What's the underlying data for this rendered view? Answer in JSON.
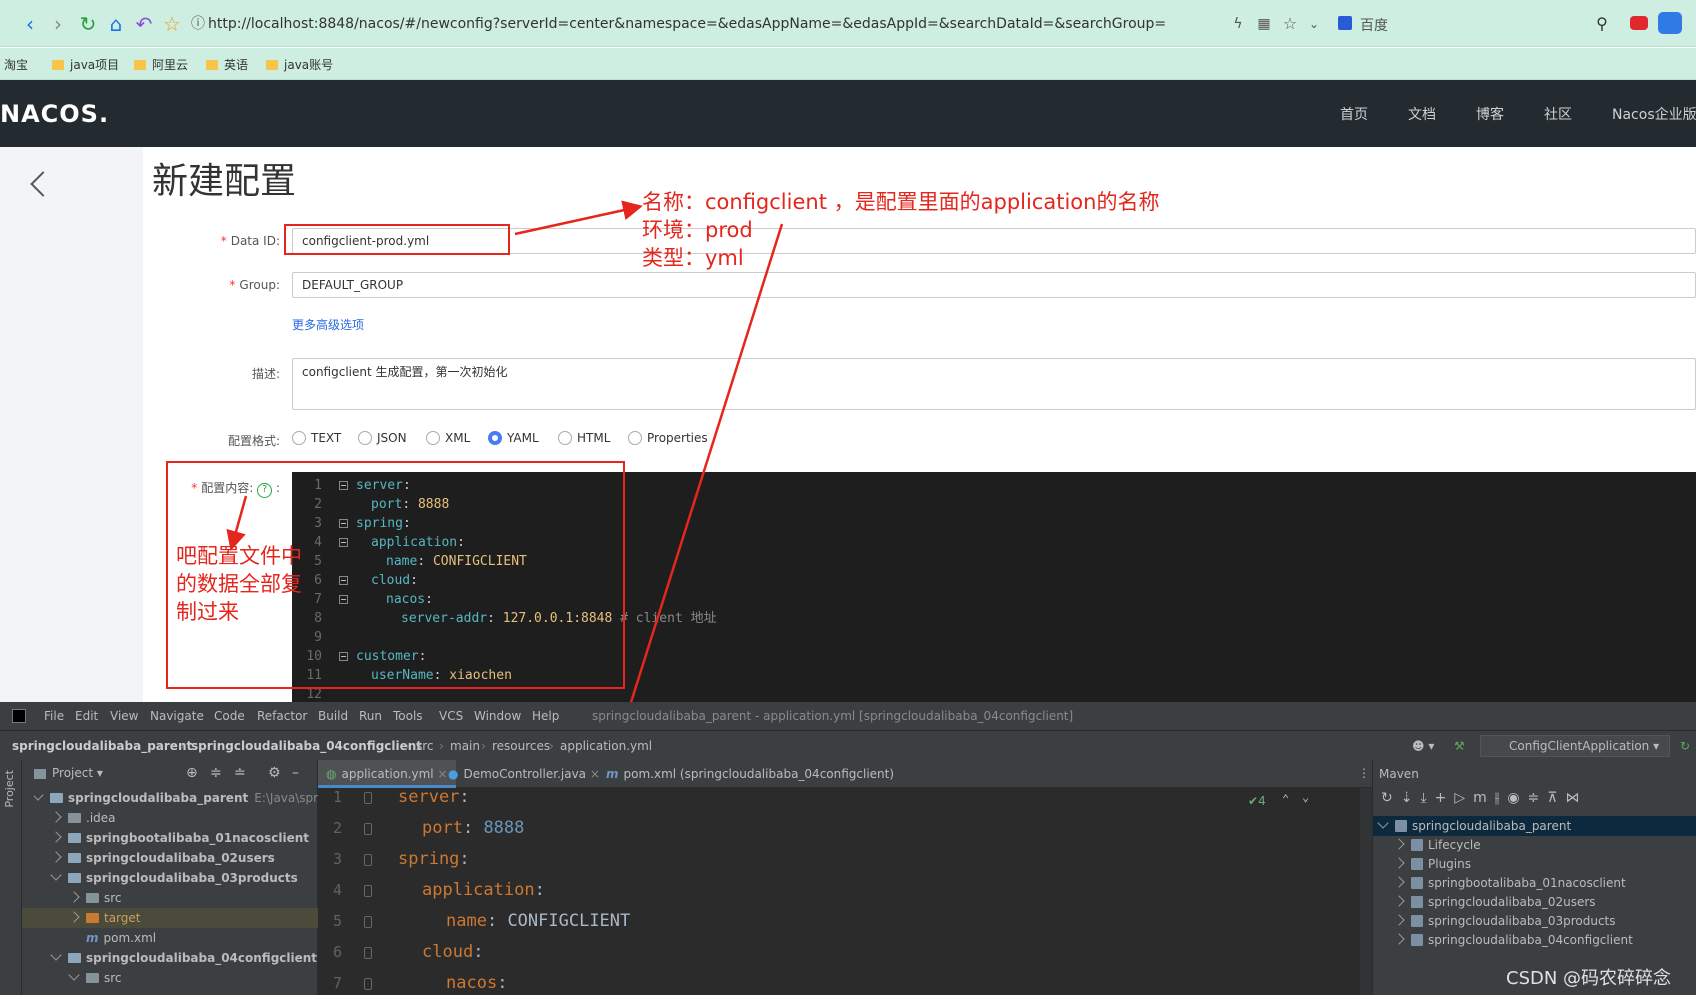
{
  "browser": {
    "url": "http://localhost:8848/nacos/#/newconfig?serverId=center&namespace=&edasAppName=&edasAppId=&searchDataId=&searchGroup=",
    "search_engine": "百度",
    "bookmarks": [
      "淘宝",
      "java项目",
      "阿里云",
      "英语",
      "java账号"
    ]
  },
  "nacos": {
    "logo": "NACOS.",
    "nav": [
      "首页",
      "文档",
      "博客",
      "社区",
      "Nacos企业版"
    ],
    "page_title": "新建配置",
    "form": {
      "data_id_label": "Data ID:",
      "data_id_value": "configclient-prod.yml",
      "group_label": "Group:",
      "group_value": "DEFAULT_GROUP",
      "advanced_link": "更多高级选项",
      "desc_label": "描述:",
      "desc_value": "configclient 生成配置，第一次初始化",
      "format_label": "配置格式:",
      "formats": [
        "TEXT",
        "JSON",
        "XML",
        "YAML",
        "HTML",
        "Properties"
      ],
      "format_selected": "YAML",
      "content_label": "配置内容:",
      "help_icon": "?",
      "colon": ":"
    },
    "editor_lines": [
      {
        "n": "1",
        "key": "server",
        "val": ""
      },
      {
        "n": "2",
        "key": "port",
        "val": "8888"
      },
      {
        "n": "3",
        "key": "spring",
        "val": ""
      },
      {
        "n": "4",
        "key": "application",
        "val": ""
      },
      {
        "n": "5",
        "key": "name",
        "val": "CONFIGCLIENT"
      },
      {
        "n": "6",
        "key": "cloud",
        "val": ""
      },
      {
        "n": "7",
        "key": "nacos",
        "val": ""
      },
      {
        "n": "8",
        "key": "server-addr",
        "val": "127.0.0.1:8848",
        "comment": "# client 地址"
      },
      {
        "n": "9",
        "key": "",
        "val": ""
      },
      {
        "n": "10",
        "key": "customer",
        "val": ""
      },
      {
        "n": "11",
        "key": "userName",
        "val": "xiaochen"
      },
      {
        "n": "12",
        "key": "",
        "val": ""
      }
    ]
  },
  "annotations": {
    "note_name": "名称：configclient ，是配置里面的application的名称",
    "note_env": "环境：prod",
    "note_type": "类型：yml",
    "note_copy": "吧配置文件中的数据全部复制过来"
  },
  "ide": {
    "menu": [
      "File",
      "Edit",
      "View",
      "Navigate",
      "Code",
      "Refactor",
      "Build",
      "Run",
      "Tools",
      "VCS",
      "Window",
      "Help"
    ],
    "title": "springcloudalibaba_parent - application.yml [springcloudalibaba_04configclient]",
    "breadcrumb": [
      "springcloudalibaba_parent",
      "springcloudalibaba_04configclient",
      "src",
      "main",
      "resources",
      "application.yml"
    ],
    "run_config": "ConfigClientApplication",
    "project_label": "Project",
    "left_strip_label": "Project",
    "tree": [
      {
        "label": "springcloudalibaba_parent",
        "extra": "E:\\Java\\springCl",
        "depth": 0,
        "open": true,
        "kind": "mod"
      },
      {
        "label": ".idea",
        "depth": 1,
        "open": false,
        "kind": "dir"
      },
      {
        "label": "springbootalibaba_01nacosclient",
        "depth": 1,
        "open": false,
        "kind": "mod"
      },
      {
        "label": "springcloudalibaba_02users",
        "depth": 1,
        "open": false,
        "kind": "mod"
      },
      {
        "label": "springcloudalibaba_03products",
        "depth": 1,
        "open": true,
        "kind": "mod"
      },
      {
        "label": "src",
        "depth": 2,
        "open": false,
        "kind": "dir"
      },
      {
        "label": "target",
        "depth": 2,
        "open": false,
        "kind": "tgt"
      },
      {
        "label": "pom.xml",
        "depth": 2,
        "open": null,
        "kind": "pom"
      },
      {
        "label": "springcloudalibaba_04configclient",
        "depth": 1,
        "open": true,
        "kind": "mod"
      },
      {
        "label": "src",
        "depth": 2,
        "open": true,
        "kind": "dir"
      }
    ],
    "tabs": [
      "application.yml",
      "DemoController.java",
      "pom.xml (springcloudalibaba_04configclient)"
    ],
    "inspection": "4",
    "code": [
      {
        "n": "1",
        "indent": 0,
        "key": "server",
        "val": ""
      },
      {
        "n": "2",
        "indent": 1,
        "key": "port",
        "val": "8888"
      },
      {
        "n": "3",
        "indent": 0,
        "key": "spring",
        "val": ""
      },
      {
        "n": "4",
        "indent": 1,
        "key": "application",
        "val": ""
      },
      {
        "n": "5",
        "indent": 2,
        "key": "name",
        "val": "CONFIGCLIENT"
      },
      {
        "n": "6",
        "indent": 1,
        "key": "cloud",
        "val": ""
      },
      {
        "n": "7",
        "indent": 2,
        "key": "nacos",
        "val": ""
      }
    ],
    "maven_title": "Maven",
    "maven_tree": [
      {
        "label": "springcloudalibaba_parent",
        "depth": 0
      },
      {
        "label": "Lifecycle",
        "depth": 1
      },
      {
        "label": "Plugins",
        "depth": 1
      },
      {
        "label": "springbootalibaba_01nacosclient",
        "depth": 1
      },
      {
        "label": "springcloudalibaba_02users",
        "depth": 1
      },
      {
        "label": "springcloudalibaba_03products",
        "depth": 1
      },
      {
        "label": "springcloudalibaba_04configclient",
        "depth": 1
      }
    ]
  },
  "watermark": "CSDN @码农碎碎念",
  "colors": {
    "accent": "#e5261d",
    "nacos_header": "#232b31",
    "ide_bg": "#3c3f41"
  }
}
